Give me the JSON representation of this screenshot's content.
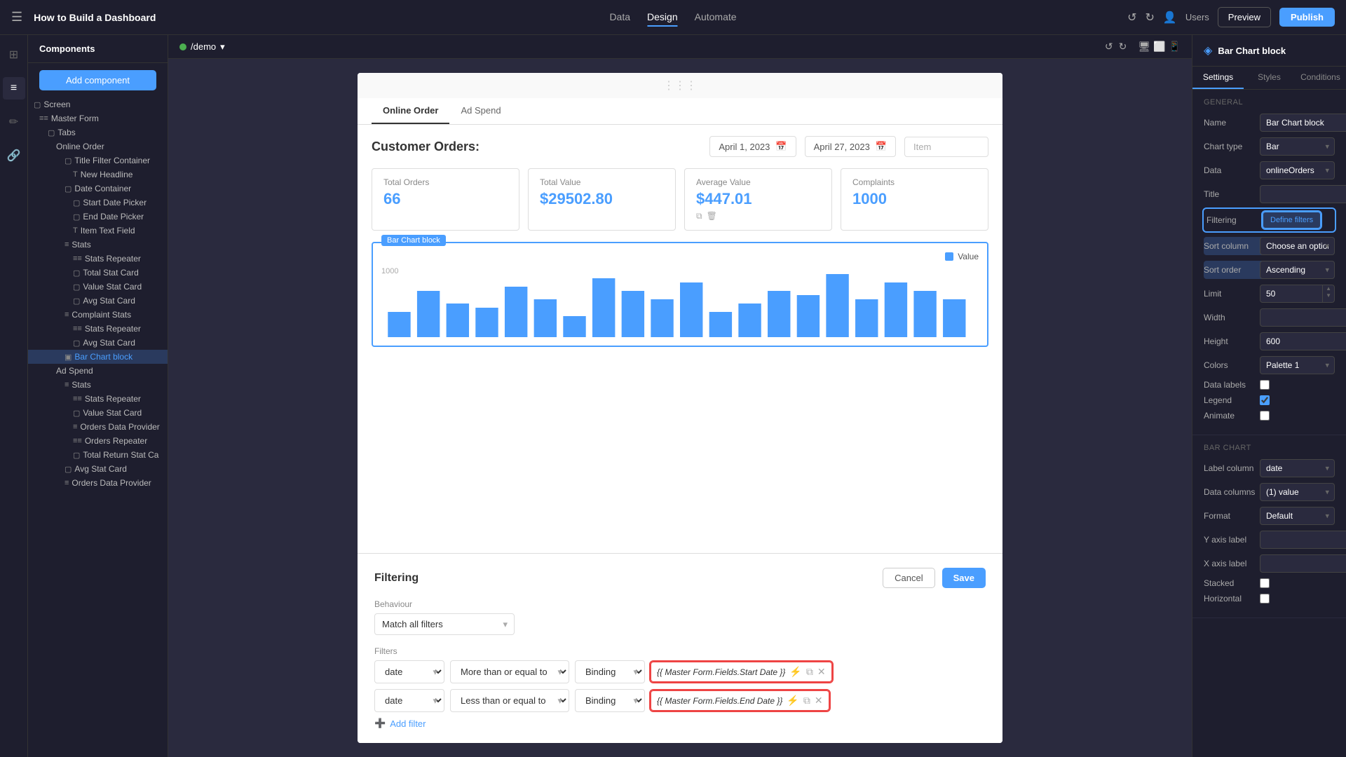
{
  "app": {
    "title": "How to Build a Dashboard",
    "nav_items": [
      "Data",
      "Design",
      "Automate"
    ],
    "active_nav": "Design",
    "users_label": "Users",
    "preview_label": "Preview",
    "publish_label": "Publish"
  },
  "demo": {
    "label": "/demo"
  },
  "component_tree": {
    "header": "Components",
    "add_button": "Add component",
    "items": [
      {
        "id": "screen",
        "label": "Screen",
        "indent": 0,
        "icon": "▢"
      },
      {
        "id": "master-form",
        "label": "Master Form",
        "indent": 1,
        "icon": "≡≡"
      },
      {
        "id": "tabs",
        "label": "Tabs",
        "indent": 2,
        "icon": "▢"
      },
      {
        "id": "online-order",
        "label": "Online Order",
        "indent": 3,
        "icon": ""
      },
      {
        "id": "title-filter",
        "label": "Title Filter Container",
        "indent": 4,
        "icon": "▢"
      },
      {
        "id": "new-headline",
        "label": "New Headline",
        "indent": 5,
        "icon": "T"
      },
      {
        "id": "date-container",
        "label": "Date Container",
        "indent": 4,
        "icon": "▢"
      },
      {
        "id": "start-date-picker",
        "label": "Start Date Picker",
        "indent": 5,
        "icon": "▢"
      },
      {
        "id": "end-date-picker",
        "label": "End Date Picker",
        "indent": 5,
        "icon": "▢"
      },
      {
        "id": "item-text-field",
        "label": "Item Text Field",
        "indent": 5,
        "icon": "T"
      },
      {
        "id": "stats",
        "label": "Stats",
        "indent": 4,
        "icon": "≡"
      },
      {
        "id": "stats-repeater",
        "label": "Stats Repeater",
        "indent": 5,
        "icon": "≡≡"
      },
      {
        "id": "total-stat-card",
        "label": "Total Stat Card",
        "indent": 6,
        "icon": "▢"
      },
      {
        "id": "value-stat-card",
        "label": "Value Stat Card",
        "indent": 6,
        "icon": "▢"
      },
      {
        "id": "avg-stat-card",
        "label": "Avg Stat Card",
        "indent": 6,
        "icon": "▢"
      },
      {
        "id": "complaint-stats",
        "label": "Complaint Stats",
        "indent": 5,
        "icon": "≡"
      },
      {
        "id": "complaint-stats-repeater",
        "label": "Stats Repeater",
        "indent": 6,
        "icon": "≡≡"
      },
      {
        "id": "complaint-avg-stat-card",
        "label": "Avg Stat Card",
        "indent": 7,
        "icon": "▢"
      },
      {
        "id": "bar-chart-block",
        "label": "Bar Chart block",
        "indent": 4,
        "icon": "▣",
        "selected": true
      },
      {
        "id": "ad-spend",
        "label": "Ad Spend",
        "indent": 3,
        "icon": ""
      },
      {
        "id": "stats2",
        "label": "Stats",
        "indent": 4,
        "icon": "≡"
      },
      {
        "id": "stats-repeater2",
        "label": "Stats Repeater",
        "indent": 5,
        "icon": "≡≡"
      },
      {
        "id": "value-stat-card2",
        "label": "Value Stat Card",
        "indent": 6,
        "icon": "▢"
      },
      {
        "id": "orders-data-provider",
        "label": "Orders Data Provider",
        "indent": 5,
        "icon": "≡"
      },
      {
        "id": "orders-repeater",
        "label": "Orders Repeater",
        "indent": 6,
        "icon": "≡≡"
      },
      {
        "id": "total-return-stat-ca",
        "label": "Total Return Stat Ca",
        "indent": 7,
        "icon": "▢"
      },
      {
        "id": "avg-stat-card2",
        "label": "Avg Stat Card",
        "indent": 5,
        "icon": "▢"
      },
      {
        "id": "orders-data-provider2",
        "label": "Orders Data Provider",
        "indent": 5,
        "icon": "≡"
      }
    ]
  },
  "canvas": {
    "tabs": [
      "Online Order",
      "Ad Spend"
    ],
    "active_tab": "Online Order",
    "customer_orders_title": "Customer Orders:",
    "start_date": "April 1, 2023",
    "end_date": "April 27, 2023",
    "item_placeholder": "Item",
    "stats": [
      {
        "label": "Total Orders",
        "value": "66"
      },
      {
        "label": "Total Value",
        "value": "$29502.80"
      },
      {
        "label": "Average Value",
        "value": "$447.01"
      },
      {
        "label": "Complaints",
        "value": "1000"
      }
    ],
    "chart_badge": "Bar Chart block",
    "chart_legend_label": "Value",
    "chart_y_label": "1000",
    "chart_bars": [
      30,
      55,
      40,
      35,
      60,
      45,
      25,
      70,
      55,
      45,
      65,
      30,
      40,
      55,
      50,
      75,
      45,
      65,
      55,
      45
    ]
  },
  "filtering": {
    "title": "Filtering",
    "behaviour_label": "Behaviour",
    "behaviour_option": "Match all filters",
    "filters_label": "Filters",
    "filter_rows": [
      {
        "field": "date",
        "operator": "More than or equal to",
        "type": "Binding",
        "value": "{{ Master Form.Fields.Start Date }}"
      },
      {
        "field": "date",
        "operator": "Less than or equal to",
        "type": "Binding",
        "value": "{{ Master Form.Fields.End Date }}"
      }
    ],
    "add_filter_label": "Add filter",
    "cancel_label": "Cancel",
    "save_label": "Save"
  },
  "right_panel": {
    "title": "Bar Chart block",
    "tabs": [
      "Settings",
      "Styles",
      "Conditions"
    ],
    "active_tab": "Settings",
    "general_section": "GENERAL",
    "fields": {
      "name_label": "Name",
      "name_value": "Bar Chart block",
      "chart_type_label": "Chart type",
      "chart_type_value": "Bar",
      "data_label": "Data",
      "data_value": "onlineOrders",
      "title_label": "Title",
      "filtering_label": "Filtering",
      "filtering_btn": "Define filters",
      "sort_column_label": "Sort column",
      "sort_column_value": "Choose an option",
      "sort_order_label": "Sort order",
      "sort_order_value": "Ascending",
      "limit_label": "Limit",
      "limit_value": "50",
      "width_label": "Width",
      "height_label": "Height",
      "height_value": "600",
      "colors_label": "Colors",
      "colors_value": "Palette 1",
      "data_labels_label": "Data labels",
      "legend_label": "Legend",
      "animate_label": "Animate"
    },
    "bar_chart_section": "BAR CHART",
    "bar_chart_fields": {
      "label_column_label": "Label column",
      "label_column_value": "date",
      "data_columns_label": "Data columns",
      "data_columns_value": "(1) value",
      "format_label": "Format",
      "format_value": "Default",
      "y_axis_label_label": "Y axis label",
      "x_axis_label_label": "X axis label",
      "stacked_label": "Stacked",
      "horizontal_label": "Horizontal"
    }
  }
}
